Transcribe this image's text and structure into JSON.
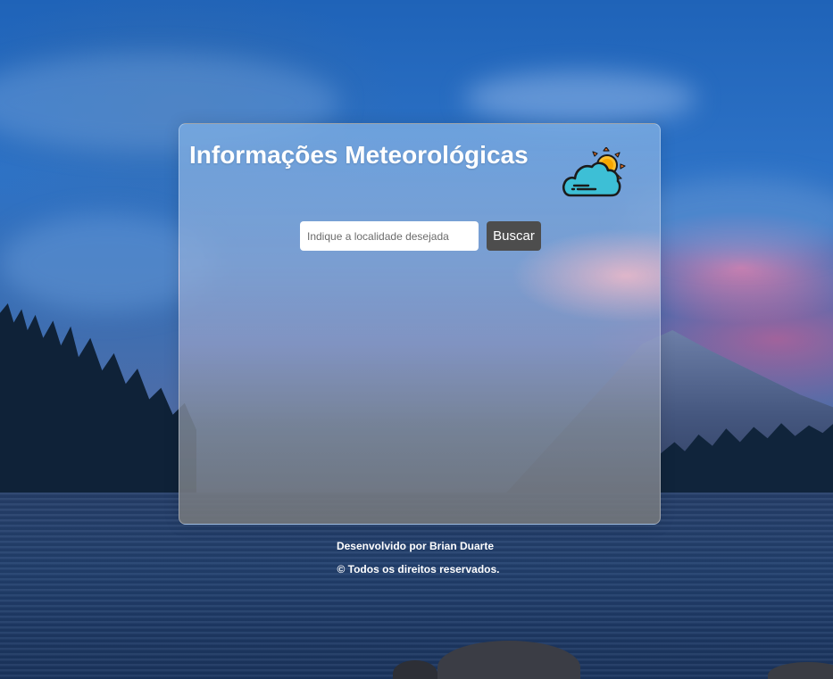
{
  "app": {
    "title": "Informações Meteorológicas",
    "icon": "weather-cloud-sun-wind-icon"
  },
  "search": {
    "placeholder": "Indique a localidade desejada",
    "value": "",
    "button_label": "Buscar"
  },
  "footer": {
    "credit": "Desenvolvido por Brian Duarte",
    "rights": "© Todos os direitos reservados."
  },
  "colors": {
    "title_text": "#ffffff",
    "button_bg": "#4d4d4d",
    "button_text": "#ffffff",
    "input_bg": "#ffffff"
  }
}
